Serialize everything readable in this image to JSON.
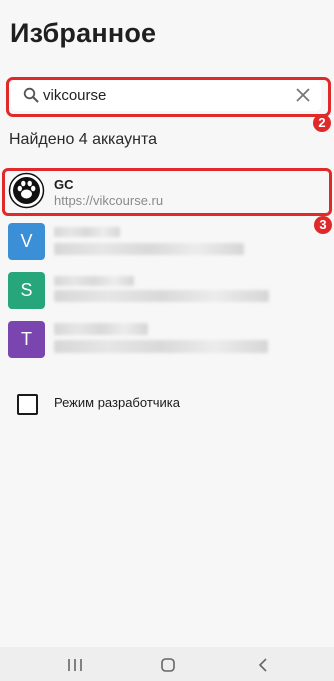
{
  "page": {
    "title": "Избранное"
  },
  "search": {
    "value": "vikcourse",
    "badge": "2"
  },
  "results": {
    "found_text": "Найдено 4 аккаунта"
  },
  "accounts": [
    {
      "initial": "",
      "name": "GC",
      "url": "https://vikcourse.ru",
      "color": "#ffffff",
      "icon": "paw-icon",
      "badge": "3"
    },
    {
      "initial": "V",
      "color": "#3b8fd6"
    },
    {
      "initial": "S",
      "color": "#26a67a"
    },
    {
      "initial": "T",
      "color": "#7b45b0"
    }
  ],
  "developer_mode": {
    "label": "Режим разработчика",
    "checked": false
  },
  "navbar": {
    "recent": "recent-apps-icon",
    "home": "home-icon",
    "back": "back-icon"
  },
  "colors": {
    "highlight": "#e02a2a",
    "background": "#f7f7f7"
  }
}
